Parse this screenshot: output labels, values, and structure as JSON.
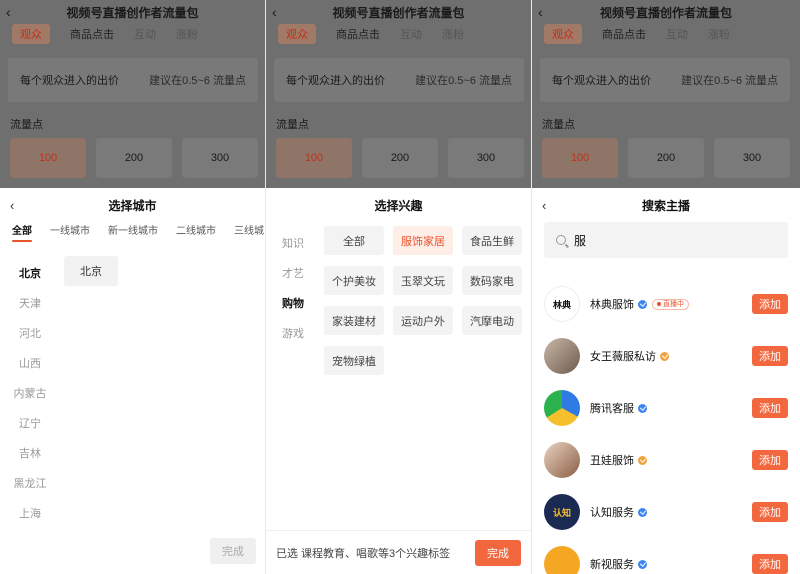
{
  "background": {
    "page_title": "视频号直播创作者流量包",
    "tabs": [
      "观众",
      "商品点击",
      "互动",
      "涨粉"
    ],
    "bid_label": "每个观众进入的出价",
    "bid_hint": "建议在0.5~6 流量点",
    "points_title": "流量点",
    "points": [
      "100",
      "200",
      "300"
    ]
  },
  "city_panel": {
    "title": "选择城市",
    "tabs": [
      "全部",
      "一线城市",
      "新一线城市",
      "二线城市",
      "三线城"
    ],
    "provinces": [
      "北京",
      "天津",
      "河北",
      "山西",
      "内蒙古",
      "辽宁",
      "吉林",
      "黑龙江",
      "上海"
    ],
    "selected_city": "北京",
    "done_label": "完成"
  },
  "interest_panel": {
    "title": "选择兴趣",
    "categories": [
      "知识",
      "才艺",
      "购物",
      "游戏"
    ],
    "chips": [
      "全部",
      "服饰家居",
      "食品生鲜",
      "个护美妆",
      "玉翠文玩",
      "数码家电",
      "家装建材",
      "运动户外",
      "汽摩电动",
      "宠物绿植"
    ],
    "selected_summary": "已选 课程教育、唱歌等3个兴趣标签",
    "done_label": "完成"
  },
  "host_panel": {
    "title": "搜索主播",
    "search_value": "服",
    "live_badge": "直播中",
    "add_label": "添加",
    "hosts": [
      {
        "name": "林典服饰",
        "avatar_text": "林典",
        "verify_color": "#3d86f0"
      },
      {
        "name": "女王薇服私访",
        "avatar_text": "",
        "verify_color": "#f0a23d"
      },
      {
        "name": "腾讯客服",
        "avatar_text": "",
        "verify_color": "#3d86f0"
      },
      {
        "name": "丑娃服饰",
        "avatar_text": "",
        "verify_color": "#f0a23d"
      },
      {
        "name": "认知服务",
        "avatar_text": "认知",
        "verify_color": "#3d86f0"
      },
      {
        "name": "新视服务",
        "avatar_text": "",
        "verify_color": "#3d86f0"
      }
    ]
  },
  "colors": {
    "accent": "#f2673e",
    "accent_text": "#e8542c"
  }
}
